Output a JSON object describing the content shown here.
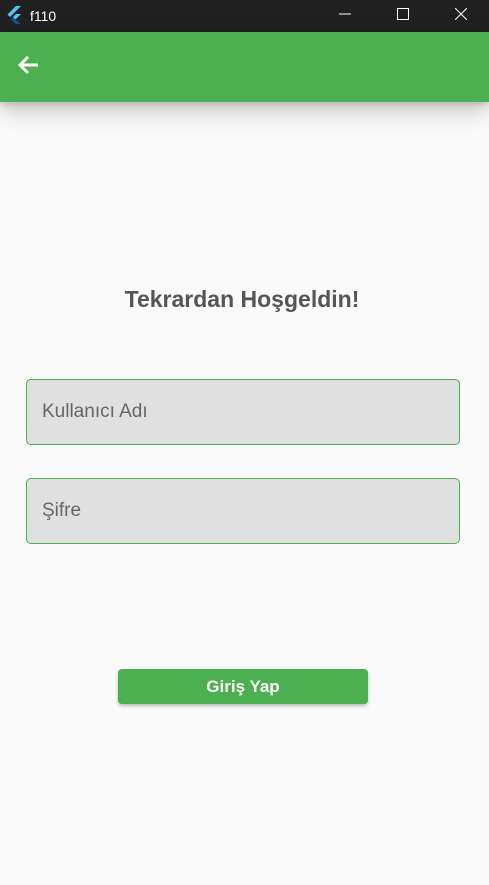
{
  "window": {
    "title": "f110",
    "icon": "flutter-logo",
    "controls": [
      "minimize-icon",
      "maximize-icon",
      "close-icon"
    ]
  },
  "appbar": {
    "back_icon": "arrow-left-icon",
    "color": "#4caf50"
  },
  "main": {
    "heading": "Tekrardan Hoşgeldin!",
    "username_field": {
      "placeholder": "Kullanıcı Adı",
      "value": ""
    },
    "password_field": {
      "placeholder": "Şifre",
      "value": ""
    },
    "login_button": "Giriş Yap"
  },
  "colors": {
    "accent": "#4caf50",
    "background": "#fafafa",
    "field_fill": "#e0e0e0",
    "titlebar": "#202020"
  }
}
